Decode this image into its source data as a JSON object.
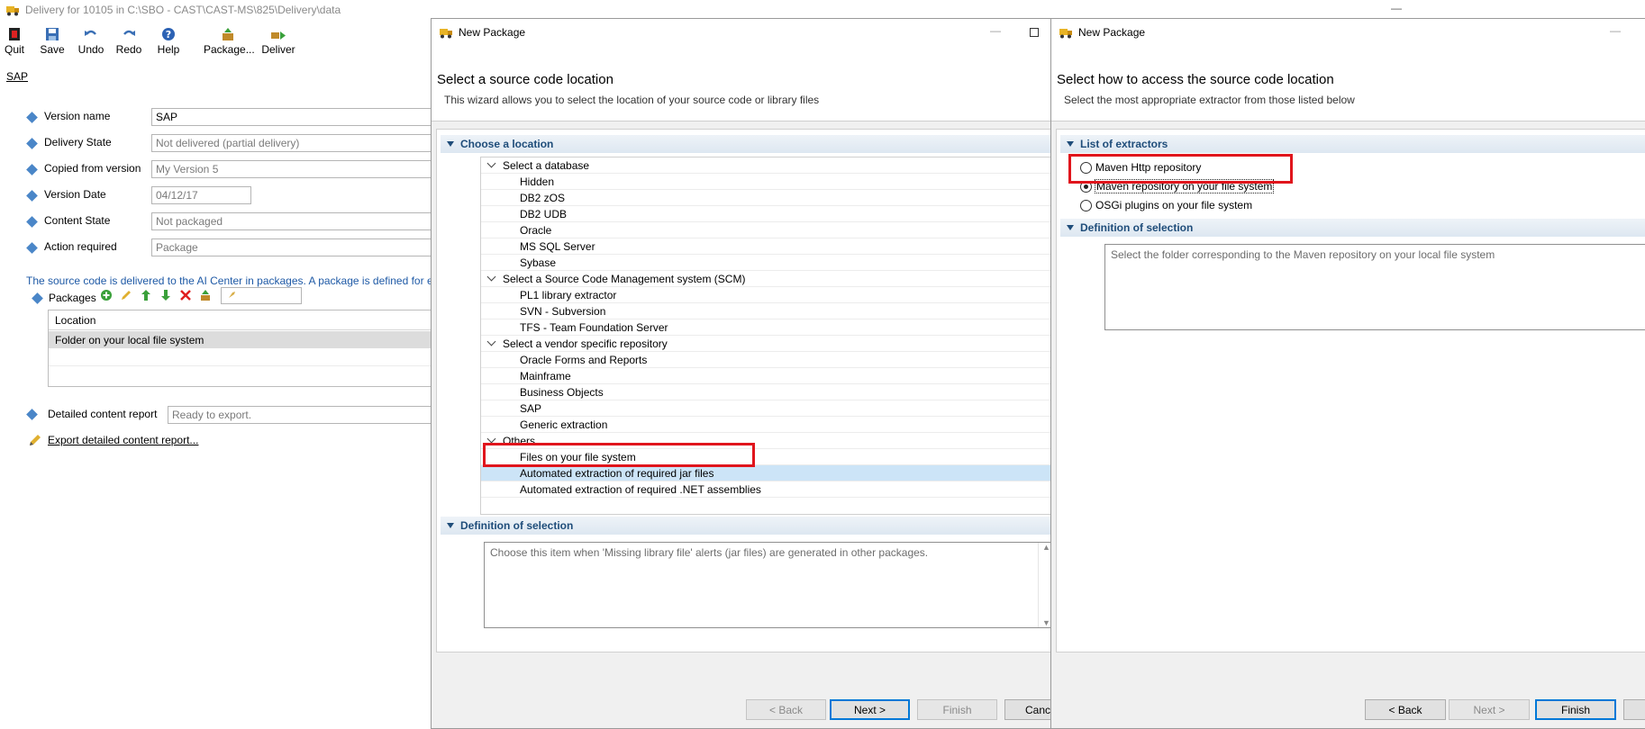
{
  "main_window": {
    "title": "Delivery for 10105 in C:\\SBO - CAST\\CAST-MS\\825\\Delivery\\data",
    "toolbar": [
      {
        "id": "quit",
        "label": "Quit",
        "icon": "quit-icon"
      },
      {
        "id": "save",
        "label": "Save",
        "icon": "save-icon"
      },
      {
        "id": "undo",
        "label": "Undo",
        "icon": "undo-icon"
      },
      {
        "id": "redo",
        "label": "Redo",
        "icon": "redo-icon"
      },
      {
        "id": "help",
        "label": "Help",
        "icon": "help-icon"
      },
      {
        "id": "package",
        "label": "Package...",
        "icon": "package-icon"
      },
      {
        "id": "deliver",
        "label": "Deliver",
        "icon": "deliver-icon"
      }
    ],
    "breadcrumb": "SAP",
    "fields": {
      "version_name": {
        "label": "Version name",
        "value": "SAP"
      },
      "delivery_state": {
        "label": "Delivery State",
        "value": "Not delivered (partial delivery)"
      },
      "copied_from": {
        "label": "Copied from version",
        "value": "My Version 5"
      },
      "version_date": {
        "label": "Version Date",
        "value": "04/12/17"
      },
      "content_state": {
        "label": "Content State",
        "value": "Not packaged"
      },
      "action_required": {
        "label": "Action required",
        "value": "Package"
      }
    },
    "info_text": "The source code is delivered to the AI Center in packages. A package is defined for eac",
    "packages_label": "Packages",
    "packages_table": {
      "column": "Location",
      "rows": [
        "Folder on your local file system"
      ]
    },
    "detailed_report": {
      "label": "Detailed content report",
      "value": "Ready to export."
    },
    "export_link": "Export detailed content report..."
  },
  "dialog1": {
    "title": "New Package",
    "heading": "Select a source code location",
    "subheading": "This wizard allows you to select the location of your source code or library files",
    "section_location": "Choose a location",
    "tree": [
      {
        "label": "Select a database",
        "type": "cat"
      },
      {
        "label": "Hidden",
        "type": "item"
      },
      {
        "label": "DB2 zOS",
        "type": "item"
      },
      {
        "label": "DB2 UDB",
        "type": "item"
      },
      {
        "label": "Oracle",
        "type": "item"
      },
      {
        "label": "MS SQL Server",
        "type": "item"
      },
      {
        "label": "Sybase",
        "type": "item"
      },
      {
        "label": "Select a Source Code Management system (SCM)",
        "type": "cat"
      },
      {
        "label": "PL1 library extractor",
        "type": "item"
      },
      {
        "label": "SVN - Subversion",
        "type": "item"
      },
      {
        "label": "TFS - Team Foundation Server",
        "type": "item"
      },
      {
        "label": "Select a vendor specific repository",
        "type": "cat"
      },
      {
        "label": "Oracle Forms and Reports",
        "type": "item"
      },
      {
        "label": "Mainframe",
        "type": "item"
      },
      {
        "label": "Business Objects",
        "type": "item"
      },
      {
        "label": "SAP",
        "type": "item"
      },
      {
        "label": "Generic extraction",
        "type": "item"
      },
      {
        "label": "Others",
        "type": "cat"
      },
      {
        "label": "Files on your file system",
        "type": "item"
      },
      {
        "label": "Automated extraction of required jar files",
        "type": "item",
        "selected": true
      },
      {
        "label": "Automated extraction of required .NET assemblies",
        "type": "item"
      }
    ],
    "section_definition": "Definition of selection",
    "definition_text": "Choose this item when 'Missing library file' alerts (jar files) are generated in other packages.",
    "buttons": {
      "back": "< Back",
      "next": "Next >",
      "finish": "Finish",
      "cancel": "Canc"
    }
  },
  "dialog2": {
    "title": "New Package",
    "heading": "Select how to access the source code location",
    "subheading": "Select the most appropriate extractor from those listed below",
    "section_extractors": "List of extractors",
    "extractors": [
      {
        "label": "Maven Http repository",
        "selected": false
      },
      {
        "label": "Maven repository on your file system",
        "selected": true
      },
      {
        "label": "OSGi plugins on your file system",
        "selected": false
      }
    ],
    "section_definition": "Definition of selection",
    "definition_text": "Select the folder corresponding to the Maven repository on your local file system",
    "buttons": {
      "back": "< Back",
      "next": "Next >",
      "finish": "Finish"
    }
  },
  "colors": {
    "highlight": "#e0151c",
    "accent": "#0078d7",
    "section_text": "#1f4d7a",
    "selection": "#cce4f7"
  }
}
